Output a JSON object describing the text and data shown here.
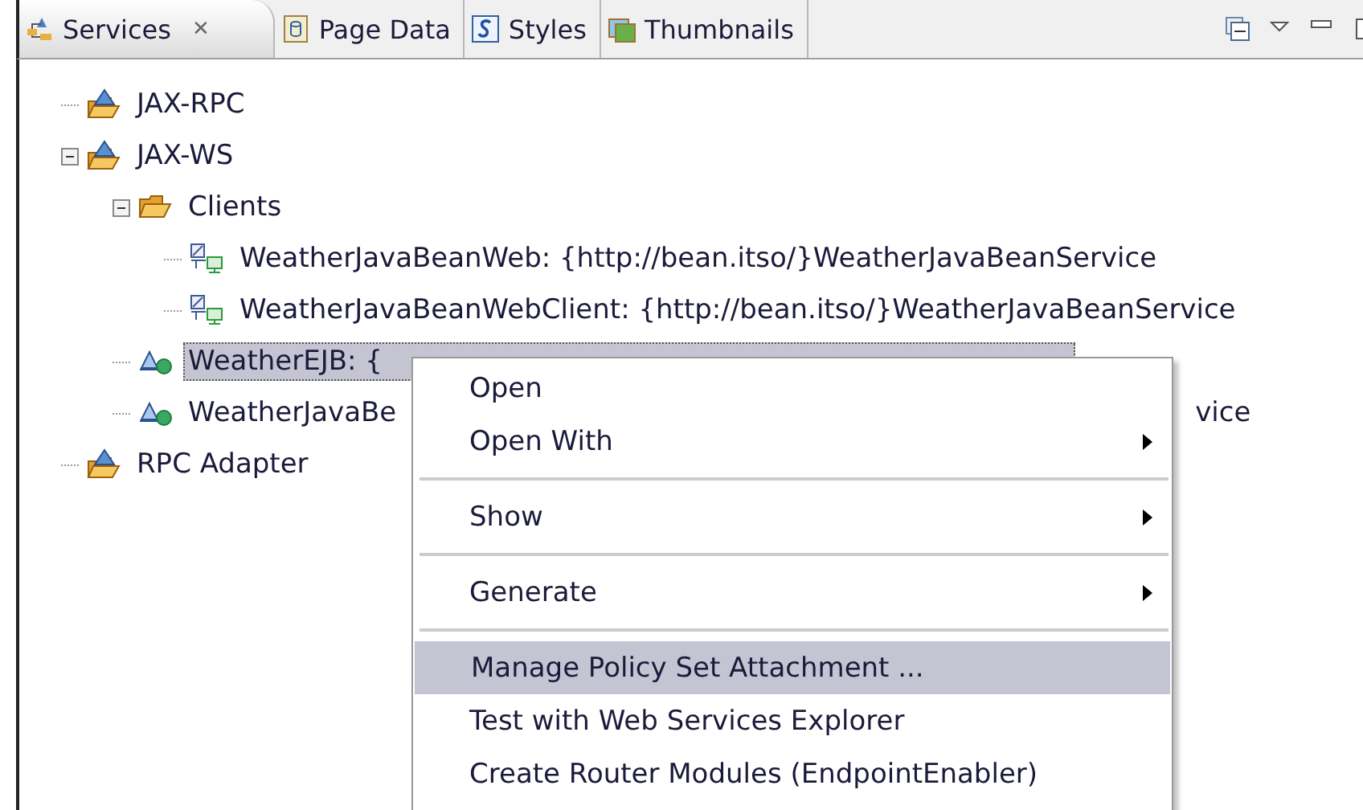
{
  "tabs": [
    {
      "label": "Services",
      "kind": "services",
      "selected": true,
      "closable": true
    },
    {
      "label": "Page Data",
      "kind": "data",
      "selected": false,
      "closable": false
    },
    {
      "label": "Styles",
      "kind": "styles",
      "selected": false,
      "closable": false
    },
    {
      "label": "Thumbnails",
      "kind": "thumbs",
      "selected": false,
      "closable": false
    }
  ],
  "close_glyph": "✕",
  "tree": [
    {
      "label": "JAX-RPC",
      "kind": "service-folder",
      "selected": false
    },
    {
      "label": "JAX-WS",
      "kind": "service-folder",
      "selected": false,
      "expanded": true,
      "children": [
        {
          "label": "Clients",
          "kind": "folder",
          "selected": false,
          "expanded": true,
          "children": [
            {
              "label": "WeatherJavaBeanWeb: {http://bean.itso/}WeatherJavaBeanService",
              "kind": "client",
              "selected": false
            },
            {
              "label": "WeatherJavaBeanWebClient: {http://bean.itso/}WeatherJavaBeanService",
              "kind": "client",
              "selected": false
            }
          ]
        },
        {
          "label": "WeatherEJB: {",
          "kind": "service",
          "selected": true
        },
        {
          "label": "WeatherJavaBe",
          "kind": "service",
          "selected": false,
          "tail": "vice"
        }
      ]
    },
    {
      "label": "RPC Adapter",
      "kind": "service-folder",
      "selected": false
    }
  ],
  "context_menu": [
    {
      "kind": "item",
      "label": "Open",
      "submenu": false,
      "selected": false
    },
    {
      "kind": "item",
      "label": "Open With",
      "submenu": true,
      "selected": false
    },
    {
      "kind": "separator"
    },
    {
      "kind": "item",
      "label": "Show",
      "submenu": true,
      "selected": false
    },
    {
      "kind": "separator"
    },
    {
      "kind": "item",
      "label": "Generate",
      "submenu": true,
      "selected": false
    },
    {
      "kind": "separator"
    },
    {
      "kind": "item",
      "label": "Manage Policy Set Attachment ...",
      "submenu": false,
      "selected": true
    },
    {
      "kind": "item",
      "label": "Test with Web Services Explorer",
      "submenu": false,
      "selected": false
    },
    {
      "kind": "item",
      "label": "Create Router Modules (EndpointEnabler)",
      "submenu": false,
      "selected": false
    }
  ]
}
